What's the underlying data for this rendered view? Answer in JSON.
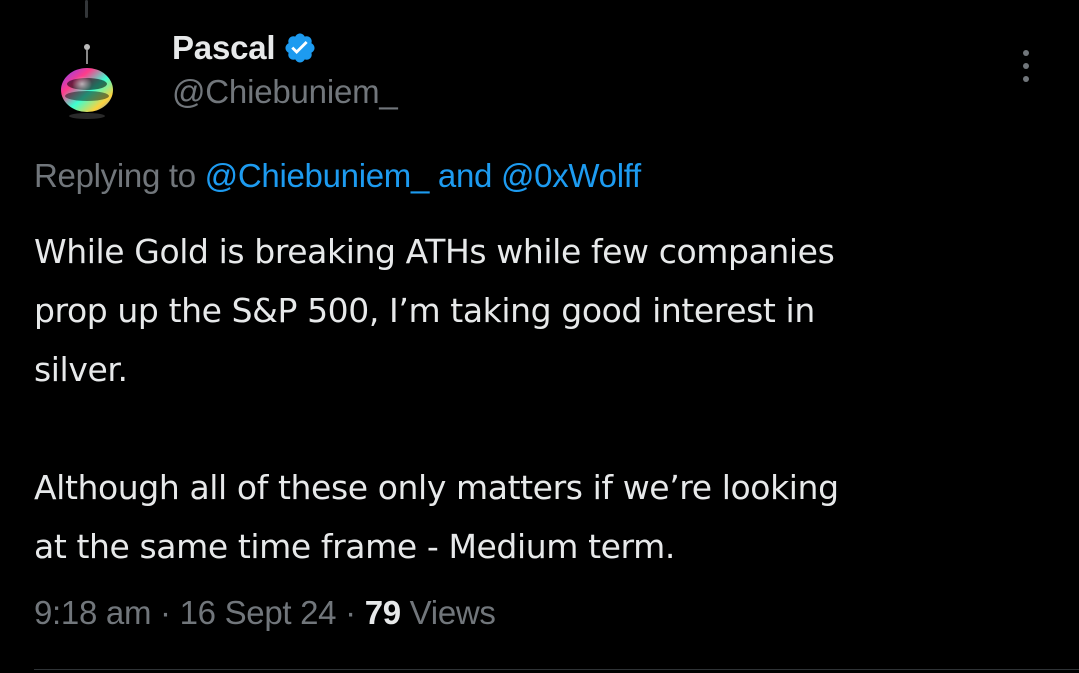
{
  "author": {
    "display_name": "Pascal",
    "handle": "@Chiebuniem_",
    "verified": true
  },
  "reply_context": {
    "prefix": "Replying to",
    "mention_1": "@Chiebuniem_",
    "conjunction": "and",
    "mention_2": "@0xWolff"
  },
  "tweet": {
    "line_1": "While Gold is breaking ATHs while few companies",
    "line_2": "prop up the S&P 500, I’m taking good interest in",
    "line_3": "silver.",
    "line_4": "Although all of these only matters if we’re looking",
    "line_5": "at the same time frame - Medium term."
  },
  "meta": {
    "time": "9:18 am",
    "separator": "·",
    "date": "16 Sept 24",
    "views_count": "79",
    "views_label": "Views"
  },
  "icons": {
    "verified": "verified-badge-icon",
    "more": "more-options-icon"
  },
  "colors": {
    "background": "#000000",
    "primary_text": "#e7e9ea",
    "secondary_text": "#71767b",
    "accent": "#1d9bf0"
  }
}
